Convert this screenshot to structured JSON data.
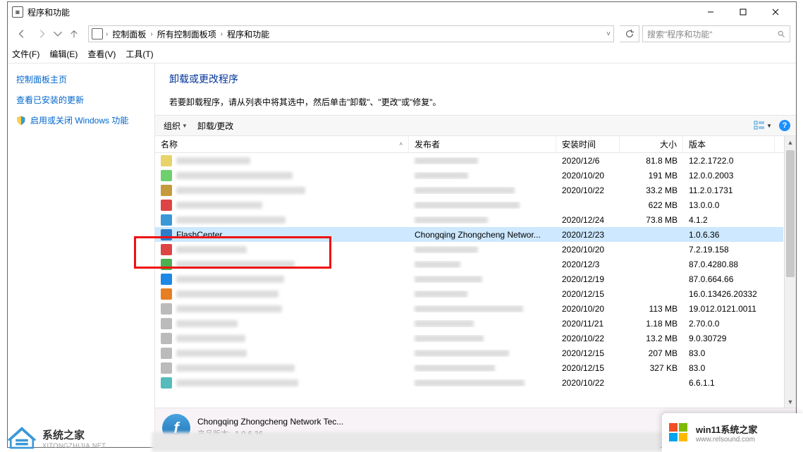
{
  "window": {
    "title": "程序和功能",
    "controls": {
      "min": "—",
      "max": "□",
      "close": "✕"
    }
  },
  "nav": {
    "crumbs": [
      "控制面板",
      "所有控制面板项",
      "程序和功能"
    ],
    "search_placeholder": "搜索\"程序和功能\"",
    "refresh_tip": "刷新"
  },
  "menu": {
    "file": "文件(F)",
    "edit": "编辑(E)",
    "view": "查看(V)",
    "tools": "工具(T)"
  },
  "sidebar": {
    "items": [
      {
        "label": "控制面板主页"
      },
      {
        "label": "查看已安装的更新"
      },
      {
        "label": "启用或关闭 Windows 功能"
      }
    ]
  },
  "main": {
    "heading": "卸载或更改程序",
    "subheading": "若要卸载程序，请从列表中将其选中，然后单击\"卸载\"、\"更改\"或\"修复\"。"
  },
  "cmdbar": {
    "organize": "组织",
    "uninstall_change": "卸载/更改"
  },
  "columns": {
    "name": "名称",
    "publisher": "发布者",
    "installed": "安装时间",
    "size": "大小",
    "version": "版本"
  },
  "rows": [
    {
      "name": "",
      "pub": "",
      "date": "2020/12/6",
      "size": "81.8 MB",
      "ver": "12.2.1722.0",
      "ico": "#e7d36a",
      "blur": true
    },
    {
      "name": "",
      "pub": "",
      "date": "2020/10/20",
      "size": "191 MB",
      "ver": "12.0.0.2003",
      "ico": "#6ecf6e",
      "blur": true
    },
    {
      "name": "",
      "pub": "",
      "date": "2020/10/22",
      "size": "33.2 MB",
      "ver": "11.2.0.1731",
      "ico": "#c59a3c",
      "blur": true
    },
    {
      "name": "",
      "pub": "",
      "date": "",
      "size": "622 MB",
      "ver": "13.0.0.0",
      "ico": "#d44",
      "blur": true
    },
    {
      "name": "",
      "pub": "",
      "date": "2020/12/24",
      "size": "73.8 MB",
      "ver": "4.1.2",
      "ico": "#3a98d8",
      "blur": true
    },
    {
      "name": "FlashCenter",
      "pub": "Chongqing Zhongcheng Networ...",
      "date": "2020/12/23",
      "size": "",
      "ver": "1.0.6.36",
      "ico": "#2c7ec9",
      "blur": false,
      "selected": true
    },
    {
      "name": "",
      "pub": "",
      "date": "2020/10/20",
      "size": "",
      "ver": "7.2.19.158",
      "ico": "#d44",
      "blur": true
    },
    {
      "name": "",
      "pub": "",
      "date": "2020/12/3",
      "size": "",
      "ver": "87.0.4280.88",
      "ico": "#4caf50",
      "blur": true
    },
    {
      "name": "",
      "pub": "",
      "date": "2020/12/19",
      "size": "",
      "ver": "87.0.664.66",
      "ico": "#1e88e5",
      "blur": true
    },
    {
      "name": "",
      "pub": "",
      "date": "2020/12/15",
      "size": "",
      "ver": "16.0.13426.20332",
      "ico": "#e67e22",
      "blur": true
    },
    {
      "name": "",
      "pub": "",
      "date": "2020/10/20",
      "size": "113 MB",
      "ver": "19.012.0121.0011",
      "ico": "#bbb",
      "blur": true
    },
    {
      "name": "",
      "pub": "",
      "date": "2020/11/21",
      "size": "1.18 MB",
      "ver": "2.70.0.0",
      "ico": "#bbb",
      "blur": true
    },
    {
      "name": "",
      "pub": "",
      "date": "2020/10/22",
      "size": "13.2 MB",
      "ver": "9.0.30729",
      "ico": "#bbb",
      "blur": true
    },
    {
      "name": "",
      "pub": "",
      "date": "2020/12/15",
      "size": "207 MB",
      "ver": "83.0",
      "ico": "#bbb",
      "blur": true
    },
    {
      "name": "",
      "pub": "",
      "date": "2020/12/15",
      "size": "327 KB",
      "ver": "83.0",
      "ico": "#bbb",
      "blur": true
    },
    {
      "name": "",
      "pub": "",
      "date": "2020/10/22",
      "size": "",
      "ver": "6.6.1.1",
      "ico": "#5bb",
      "blur": true
    }
  ],
  "detail": {
    "publisher": "Chongqing Zhongcheng Network Tec...",
    "label_version": "产品版本:",
    "version": "1.0.6.36"
  },
  "brand_left": {
    "line1": "系统之家",
    "line2": "XITONGZHIJIA.NET"
  },
  "brand_right": {
    "line1": "win11系统之家",
    "line2": "www.relsound.com"
  }
}
